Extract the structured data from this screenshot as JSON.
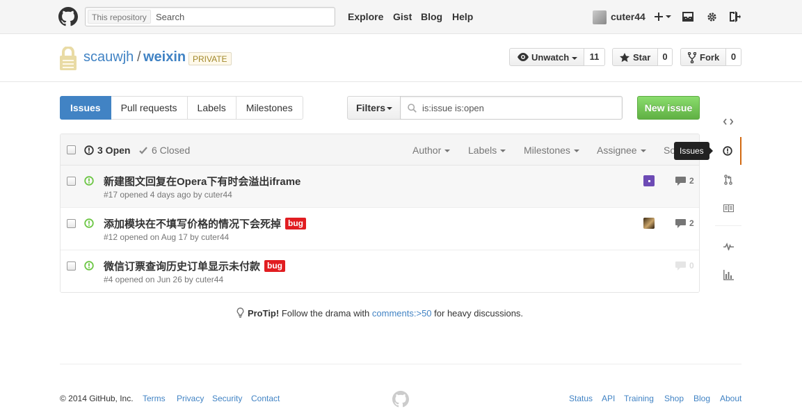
{
  "header": {
    "search_scope": "This repository",
    "search_placeholder": "Search",
    "nav": [
      "Explore",
      "Gist",
      "Blog",
      "Help"
    ],
    "username": "cuter44"
  },
  "repo": {
    "owner": "scauwjh",
    "separator": "/",
    "name": "weixin",
    "visibility": "PRIVATE",
    "unwatch_label": "Unwatch",
    "watch_count": "11",
    "star_label": "Star",
    "star_count": "0",
    "fork_label": "Fork",
    "fork_count": "0"
  },
  "subnav": {
    "tabs": [
      "Issues",
      "Pull requests",
      "Labels",
      "Milestones"
    ],
    "selected_tab": "Issues",
    "filters_label": "Filters",
    "filter_query": "is:issue is:open",
    "new_issue_label": "New issue"
  },
  "issues": {
    "open_label": "3 Open",
    "closed_label": "6 Closed",
    "header_filters": [
      "Author",
      "Labels",
      "Milestones",
      "Assignee",
      "Sort"
    ],
    "list": [
      {
        "title": "新建图文回复在Opera下有时会溢出iframe",
        "meta_prefix": "#17 opened 4 days ago by",
        "author": "cuter44",
        "label": "",
        "comments": "2"
      },
      {
        "title": "添加模块在不填写价格的情况下会死掉",
        "meta_prefix": "#12 opened on Aug 17 by",
        "author": "cuter44",
        "label": "bug",
        "comments": "2"
      },
      {
        "title": "微信订票查询历史订单显示未付款",
        "meta_prefix": "#4 opened on Jun 26 by",
        "author": "cuter44",
        "label": "bug",
        "comments": "0"
      }
    ]
  },
  "protip": {
    "lead": "ProTip!",
    "before": "Follow the drama with",
    "code": "comments:>50",
    "after": "for heavy discussions."
  },
  "sidebar": {
    "tooltip": "Issues",
    "icons": [
      "code-icon",
      "issue-icon",
      "pull-request-icon",
      "wiki-icon",
      "pulse-icon",
      "graphs-icon"
    ]
  },
  "footer": {
    "copyright": "© 2014 GitHub, Inc.",
    "left_links": [
      "Terms",
      "Privacy",
      "Security",
      "Contact"
    ],
    "right_links": [
      "Status",
      "API",
      "Training",
      "Shop",
      "Blog",
      "About"
    ]
  },
  "colors": {
    "link": "#4183c4",
    "selected_tab": "#4183c4",
    "new_issue": "#60b044",
    "open_icon": "#6cc644",
    "bug_label": "#e11d21",
    "sidebar_selected": "#d26911"
  }
}
